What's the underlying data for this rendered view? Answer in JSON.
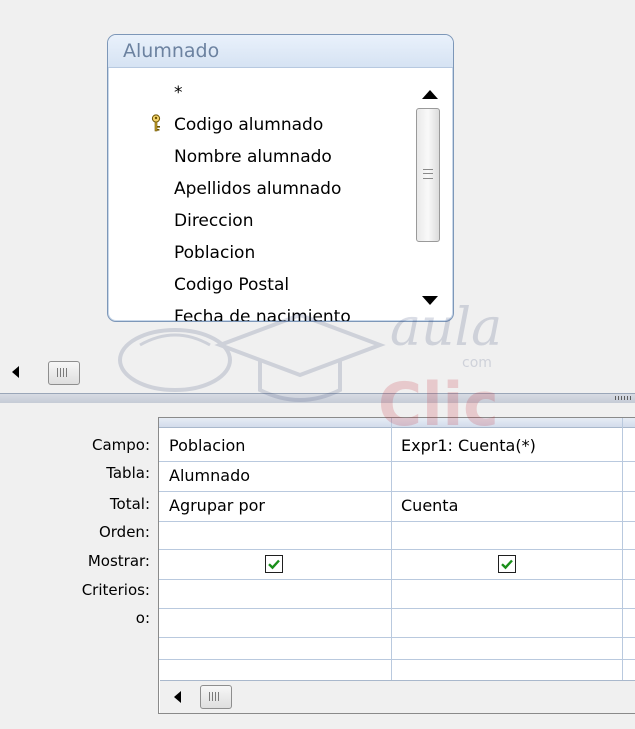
{
  "table_window": {
    "title": "Alumnado",
    "fields": [
      {
        "label": "*",
        "key": false
      },
      {
        "label": "Codigo alumnado",
        "key": true
      },
      {
        "label": "Nombre alumnado",
        "key": false
      },
      {
        "label": "Apellidos alumnado",
        "key": false
      },
      {
        "label": "Direccion",
        "key": false
      },
      {
        "label": "Poblacion",
        "key": false
      },
      {
        "label": "Codigo Postal",
        "key": false
      },
      {
        "label": "Fecha de nacimiento",
        "key": false
      }
    ]
  },
  "watermark": {
    "brand": "aula Clic",
    "sub": "com"
  },
  "grid": {
    "row_labels": {
      "field": "Campo:",
      "table": "Tabla:",
      "total": "Total:",
      "sort": "Orden:",
      "show": "Mostrar:",
      "criteria": "Criterios:",
      "or": "o:"
    },
    "columns": [
      {
        "field": "Poblacion",
        "table": "Alumnado",
        "total": "Agrupar por",
        "sort": "",
        "show": true,
        "criteria": "",
        "or": ""
      },
      {
        "field": "Expr1: Cuenta(*)",
        "table": "",
        "total": "Cuenta",
        "sort": "",
        "show": true,
        "criteria": "",
        "or": ""
      }
    ]
  },
  "colors": {
    "accent": "#7d97b8",
    "check": "#1a8f1a"
  }
}
